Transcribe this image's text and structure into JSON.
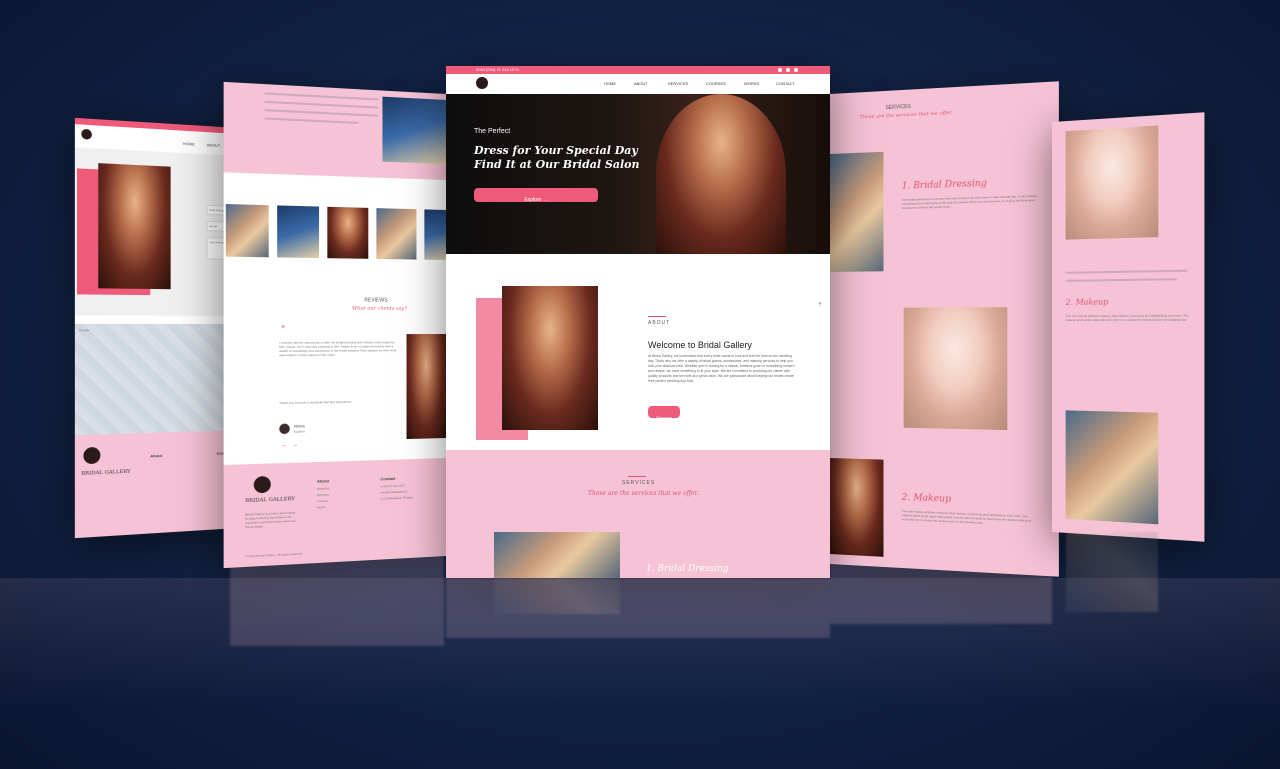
{
  "main": {
    "topbar_phone": "0094 (094) 71 243 1073",
    "nav": [
      "HOME",
      "ABOUT",
      "SERVICES",
      "COURSES",
      "WORKS",
      "CONTACT"
    ],
    "hero": {
      "kicker": "The Perfect",
      "title_line1": "Dress for Your Special Day",
      "title_line2": "Find It at Our Bridal Salon",
      "button": "Explore →"
    },
    "about": {
      "label": "ABOUT",
      "title": "Welcome to Bridal Gallery",
      "body": "At Bridal Gallery, we understand that every bride wants to look and feel her best on her wedding day. That's why we offer a variety of bridal gowns, accessories, and makeup services to help you look your absolute best. Whether you're looking for a classic, timeless gown or something modern and unique, we have something to fit your style. We are committed to providing our clients with quality products and services at a great value. We are passionate about helping our brides create their perfect wedding day look.",
      "button": "Discover"
    },
    "services": {
      "label": "SERVICES",
      "subtitle": "These are the services that we offer.",
      "first_service": "1. Bridal Dressing"
    }
  },
  "left_page": {
    "reviews_label": "REVIEWS",
    "reviews_subtitle": "What our clients say?",
    "review_text": "I recently had the opportunity to take the bridal dressing and makeup class taught by Mrs. Hasan, and I was truly impressed. Mrs. Hasan is an exceptional teacher with a wealth of knowledge and experience in the bridal industry. Their passion for their work was evident in every aspect of the class.",
    "review_thanks": "Thank you for such a wonderful learning experience!",
    "review_author": "Nisha",
    "review_role": "Student",
    "footer_about_title": "About",
    "footer_links": [
      "Bridal Art",
      "Services",
      "Courses",
      "Works"
    ],
    "footer_contact_title": "Contact",
    "footer_contact": [
      "(+94) 71 243 1073",
      "info@bridalgallery.lk",
      "123 Mahagama, Pelawa"
    ],
    "footer_desc": "Bridal Gallery is a salon and beauty boutique offering the brides to be inspiration and information about all things bridal.",
    "copyright": "© 2023 Bridal Gallery. All rights reserved.",
    "logo_text": "BRIDAL GALLERY"
  },
  "far_left_page": {
    "nav": [
      "HOME",
      "ABOUT"
    ],
    "form_fields": [
      "First Name",
      "Email",
      "Your Message"
    ],
    "footer_about_title": "About",
    "footer_contact_title": "Contact",
    "logo_text": "BRIDAL GALLERY",
    "map_label": "Google"
  },
  "right_page": {
    "services_label": "SERVICES",
    "services_subtitle": "These are the services that we offer.",
    "service1_title": "1. Bridal Dressing",
    "service1_text": "The bridal dressing is a service that helps brides look their best on their special day. It can include everything from helping the bride pick the perfect dress and accessories, to styling the bride and helping her achieve the perfect look.",
    "service2_title": "2. Makeup",
    "service2_text": "This can include airbrush makeup, false lashes, contouring and highlighting, and more. The makeup artist at the salon will usually consult with the bride to determine her desired look and work with her to create the perfect look for her wedding day."
  },
  "far_right_page": {
    "service_title": "2. Makeup",
    "service_text": "This can include airbrush makeup, false lashes, contouring and highlighting, and more. The makeup artist at the salon will work with her to create the perfect look for her wedding day."
  },
  "colors": {
    "accent": "#ef5a79",
    "pink_bg": "#f6c3d6",
    "background": "#122447"
  }
}
